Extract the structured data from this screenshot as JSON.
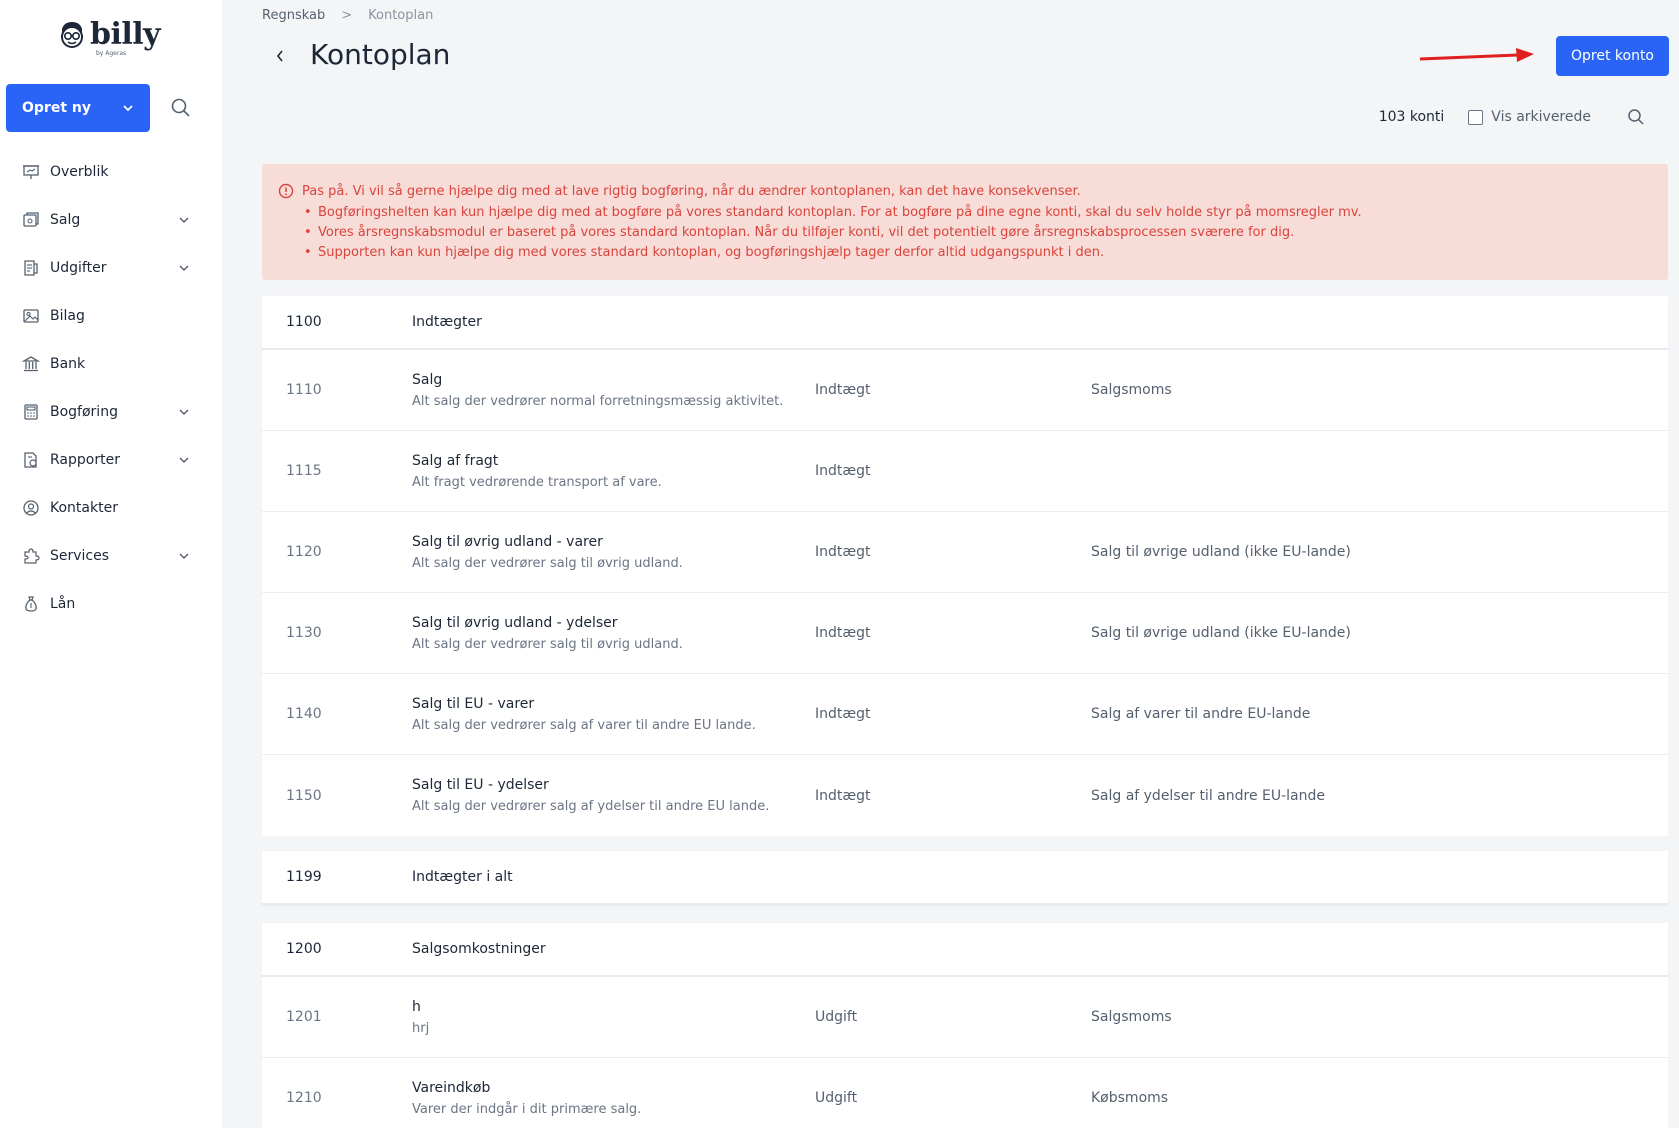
{
  "logo": {
    "name": "billy",
    "by": "by Ageras"
  },
  "sidebar": {
    "create_label": "Opret ny",
    "items": [
      {
        "label": "Overblik",
        "icon": "presentation-icon",
        "has_chevron": false
      },
      {
        "label": "Salg",
        "icon": "invoice-icon",
        "has_chevron": true
      },
      {
        "label": "Udgifter",
        "icon": "receipt-icon",
        "has_chevron": true
      },
      {
        "label": "Bilag",
        "icon": "image-icon",
        "has_chevron": false
      },
      {
        "label": "Bank",
        "icon": "bank-icon",
        "has_chevron": false
      },
      {
        "label": "Bogføring",
        "icon": "calculator-icon",
        "has_chevron": true
      },
      {
        "label": "Rapporter",
        "icon": "report-icon",
        "has_chevron": true
      },
      {
        "label": "Kontakter",
        "icon": "user-circle-icon",
        "has_chevron": false
      },
      {
        "label": "Services",
        "icon": "puzzle-icon",
        "has_chevron": true
      },
      {
        "label": "Lån",
        "icon": "money-bag-icon",
        "has_chevron": false
      }
    ]
  },
  "header": {
    "breadcrumb": [
      "Regnskab",
      "Kontoplan"
    ],
    "title": "Kontoplan",
    "create_account_label": "Opret konto"
  },
  "toolbar": {
    "count": "103 konti",
    "show_archived_label": "Vis arkiverede",
    "show_archived_checked": false
  },
  "alert": {
    "heading": "Pas på. Vi vil så gerne hjælpe dig med at lave rigtig bogføring, når du ændrer kontoplanen, kan det have konsekvenser.",
    "items": [
      "Bogføringshelten kan kun hjælpe dig med at bogføre på vores standard kontoplan. For at bogføre på dine egne konti, skal du selv holde styr på momsregler mv.",
      "Vores årsregnskabsmodul er baseret på vores standard kontoplan. Når du tilføjer konti, vil det potentielt gøre årsregnskabsprocessen sværere for dig.",
      "Supporten kan kun hjælpe dig med vores standard kontoplan, og bogføringshjælp tager derfor altid udgangspunkt i den."
    ]
  },
  "groups": [
    {
      "number": "1100",
      "name": "Indtægter",
      "accounts": [
        {
          "number": "1110",
          "title": "Salg",
          "description": "Alt salg der vedrører normal forretningsmæssig aktivitet.",
          "type": "Indtægt",
          "vat": "Salgsmoms"
        },
        {
          "number": "1115",
          "title": "Salg af fragt",
          "description": "Alt fragt vedrørende transport af vare.",
          "type": "Indtægt",
          "vat": ""
        },
        {
          "number": "1120",
          "title": "Salg til øvrig udland - varer",
          "description": "Alt salg der vedrører salg til øvrig udland.",
          "type": "Indtægt",
          "vat": "Salg til øvrige udland (ikke EU-lande)"
        },
        {
          "number": "1130",
          "title": "Salg til øvrig udland - ydelser",
          "description": "Alt salg der vedrører salg til øvrig udland.",
          "type": "Indtægt",
          "vat": "Salg til øvrige udland (ikke EU-lande)"
        },
        {
          "number": "1140",
          "title": "Salg til EU - varer",
          "description": "Alt salg der vedrører salg af varer til andre EU lande.",
          "type": "Indtægt",
          "vat": "Salg af varer til andre EU-lande"
        },
        {
          "number": "1150",
          "title": "Salg til EU - ydelser",
          "description": "Alt salg der vedrører salg af ydelser til andre EU lande.",
          "type": "Indtægt",
          "vat": "Salg af ydelser til andre EU-lande"
        }
      ]
    },
    {
      "number": "1199",
      "name": "Indtægter i alt",
      "accounts": []
    },
    {
      "number": "1200",
      "name": "Salgsomkostninger",
      "accounts": [
        {
          "number": "1201",
          "title": "h",
          "description": "hrj",
          "type": "Udgift",
          "vat": "Salgsmoms"
        },
        {
          "number": "1210",
          "title": "Vareindkøb",
          "description": "Varer der indgår i dit primære salg.",
          "type": "Udgift",
          "vat": "Købsmoms"
        }
      ]
    }
  ],
  "colors": {
    "primary": "#2a64f6",
    "alert_bg": "#f8dcd8",
    "alert_text": "#d9443c",
    "arrow": "#e02020"
  }
}
